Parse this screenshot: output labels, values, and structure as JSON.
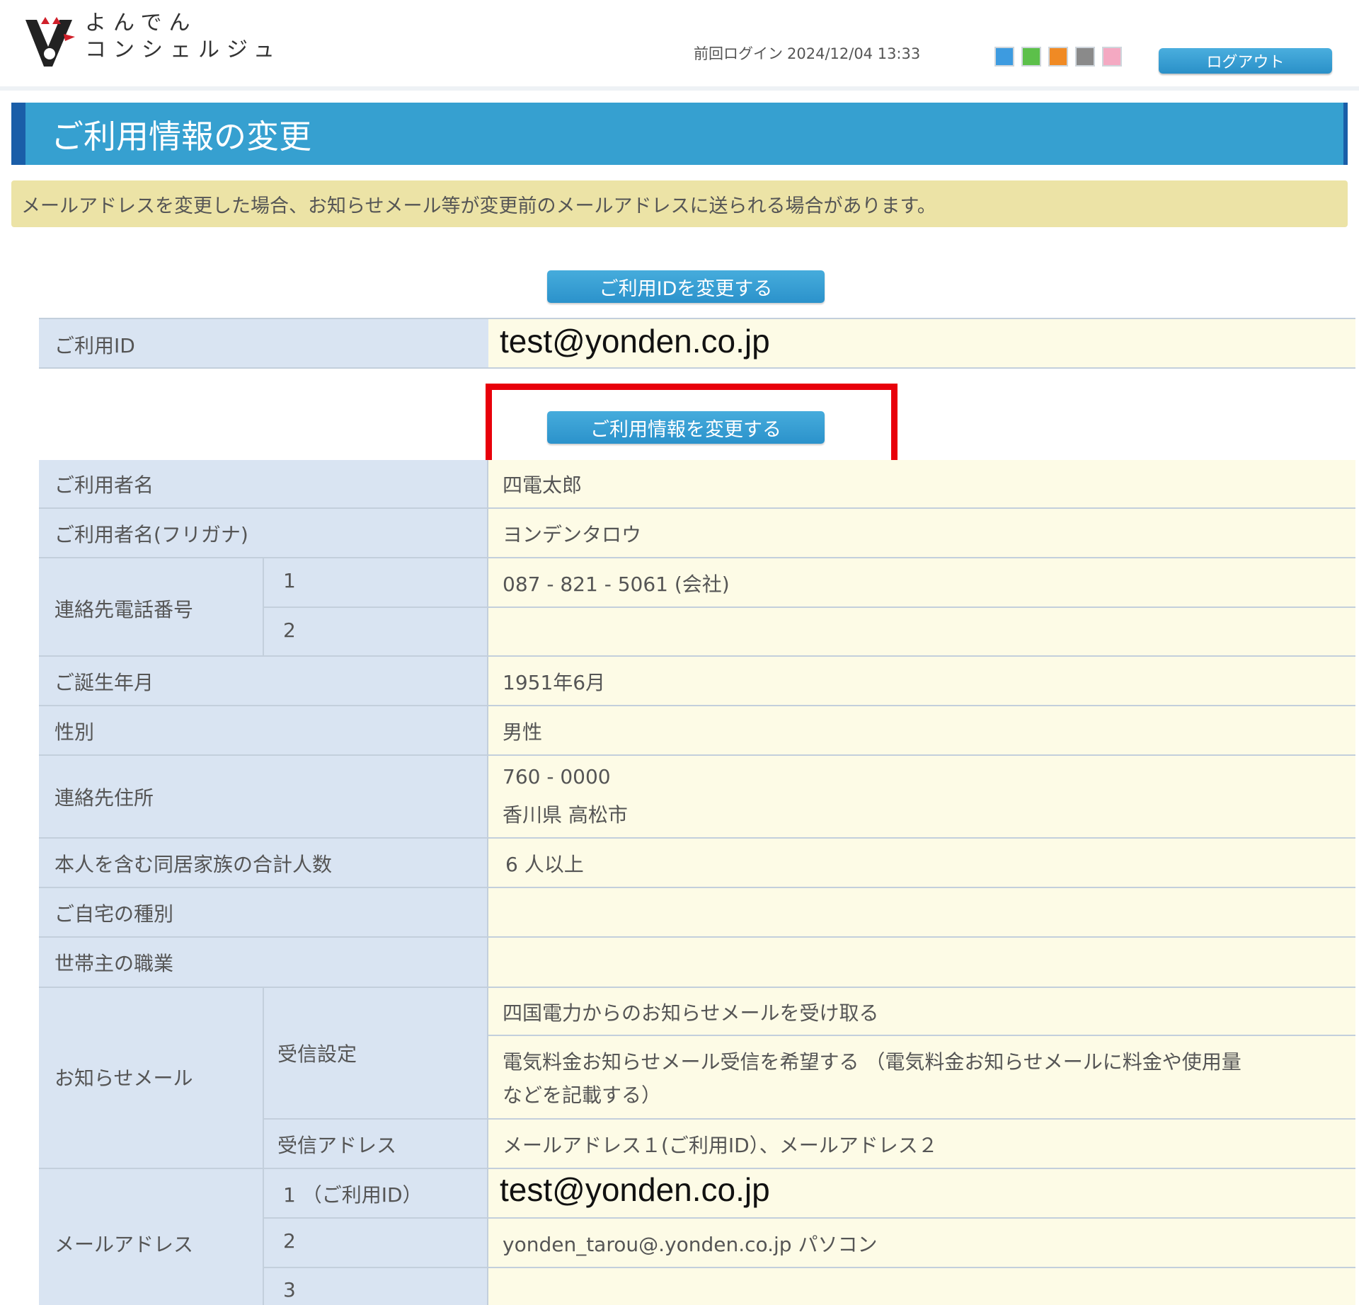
{
  "header": {
    "brand_line1": "よんでん",
    "brand_line2": "コンシェルジュ",
    "last_login_label": "前回ログイン",
    "last_login_value": "2024/12/04 13:33",
    "theme_colors": [
      "#3d9be0",
      "#5cc04a",
      "#f08a24",
      "#8a8a8a",
      "#f4a9c2"
    ],
    "logout_label": "ログアウト"
  },
  "page": {
    "title": "ご利用情報の変更",
    "notice": "メールアドレスを変更した場合、お知らせメール等が変更前のメールアドレスに送られる場合があります。",
    "change_id_button": "ご利用IDを変更する",
    "change_info_button": "ご利用情報を変更する"
  },
  "id_table": {
    "label": "ご利用ID",
    "value": "test@yonden.co.jp"
  },
  "info": {
    "name_label": "ご利用者名",
    "name_value": "四電太郎",
    "kana_label": "ご利用者名(フリガナ)",
    "kana_value": "ヨンデンタロウ",
    "phone_label": "連絡先電話番号",
    "phone1_index": "1",
    "phone1_value": "087 - 821 - 5061 (会社)",
    "phone2_index": "2",
    "phone2_value": "",
    "birth_label": "ご誕生年月",
    "birth_value": "1951年6月",
    "gender_label": "性別",
    "gender_value": "男性",
    "address_label": "連絡先住所",
    "address_zip": "760 - 0000",
    "address_city": "香川県 高松市",
    "family_label": "本人を含む同居家族の合計人数",
    "family_value": "6 人以上",
    "home_label": "ご自宅の種別",
    "home_value": "",
    "job_label": "世帯主の職業",
    "job_value": "",
    "notify_label": "お知らせメール",
    "receive_setting_label": "受信設定",
    "receive_setting_1": "四国電力からのお知らせメールを受け取る",
    "receive_setting_2a": "電気料金お知らせメール受信を希望する （電気料金お知らせメールに料金や使用量",
    "receive_setting_2b": "などを記載する）",
    "receive_address_label": "受信アドレス",
    "receive_address_value": "メールアドレス１(ご利用ID）、メールアドレス２",
    "mail_label": "メールアドレス",
    "mail1_index": "1 （ご利用ID）",
    "mail1_value": "test@yonden.co.jp",
    "mail2_index": "2",
    "mail2_value": "yonden_tarou@.yonden.co.jp パソコン",
    "mail3_index": "3",
    "mail3_value": ""
  }
}
